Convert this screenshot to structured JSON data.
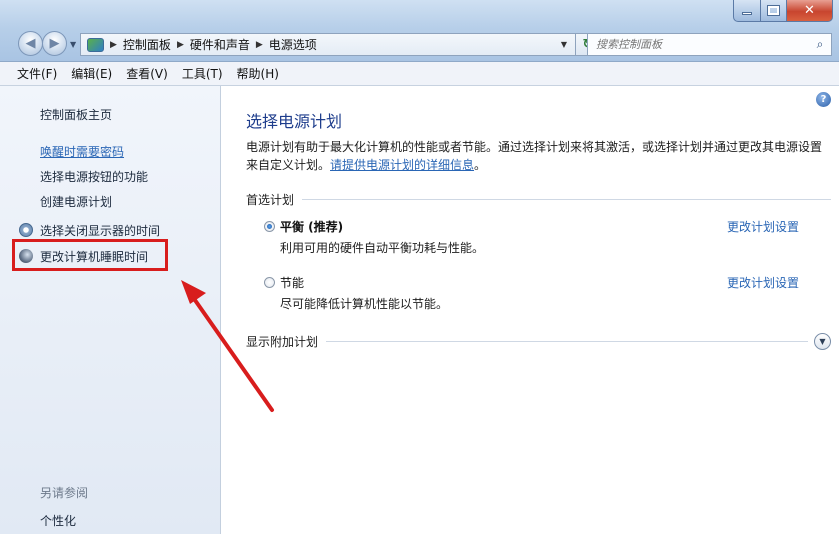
{
  "address": {
    "crumbs": [
      "控制面板",
      "硬件和声音",
      "电源选项"
    ]
  },
  "search": {
    "placeholder": "搜索控制面板"
  },
  "menu": [
    "文件(F)",
    "编辑(E)",
    "查看(V)",
    "工具(T)",
    "帮助(H)"
  ],
  "sidebar": {
    "home": "控制面板主页",
    "items": [
      "唤醒时需要密码",
      "选择电源按钮的功能",
      "创建电源计划",
      "选择关闭显示器的时间",
      "更改计算机睡眠时间"
    ],
    "see_also_title": "另请参阅",
    "see_also_items": [
      "个性化"
    ]
  },
  "main": {
    "title": "选择电源计划",
    "description_text": "电源计划有助于最大化计算机的性能或者节能。通过选择计划来将其激活，或选择计划并通过更改其电源设置来自定义计划。",
    "description_link": "请提供电源计划的详细信息",
    "description_end": "。",
    "preferred_label": "首选计划",
    "plans": [
      {
        "name": "平衡 (推荐)",
        "desc": "利用可用的硬件自动平衡功耗与性能。",
        "link": "更改计划设置",
        "selected": true
      },
      {
        "name": "节能",
        "desc": "尽可能降低计算机性能以节能。",
        "link": "更改计划设置",
        "selected": false
      }
    ],
    "additional_label": "显示附加计划"
  },
  "colors": {
    "highlight_box": "#d81d1d",
    "link": "#2a66b5",
    "title": "#1e3d8c"
  }
}
